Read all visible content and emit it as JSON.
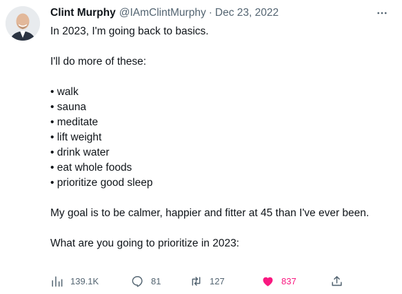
{
  "tweet": {
    "author_name": "Clint Murphy",
    "handle": "@IAmClintMurphy",
    "separator": "·",
    "date": "Dec 23, 2022",
    "paragraph1": "In 2023, I'm going back to basics.",
    "paragraph2": "I'll do more of these:",
    "bullets": [
      "• walk",
      "• sauna",
      "• meditate",
      "• lift weight",
      "• drink water",
      "• eat whole foods",
      "• prioritize good sleep"
    ],
    "paragraph3": "My goal is to be calmer, happier and fitter at 45 than I've ever been.",
    "paragraph4": "What are you going to prioritize in 2023:"
  },
  "actions": {
    "views": "139.1K",
    "replies": "81",
    "retweets": "127",
    "likes": "837"
  },
  "colors": {
    "text": "#0f1419",
    "secondary": "#536471",
    "like": "#f91880"
  },
  "icons": {
    "more": "more-dots-icon",
    "views": "analytics-icon",
    "reply": "reply-icon",
    "retweet": "retweet-icon",
    "like": "heart-filled-icon",
    "share": "share-icon"
  }
}
